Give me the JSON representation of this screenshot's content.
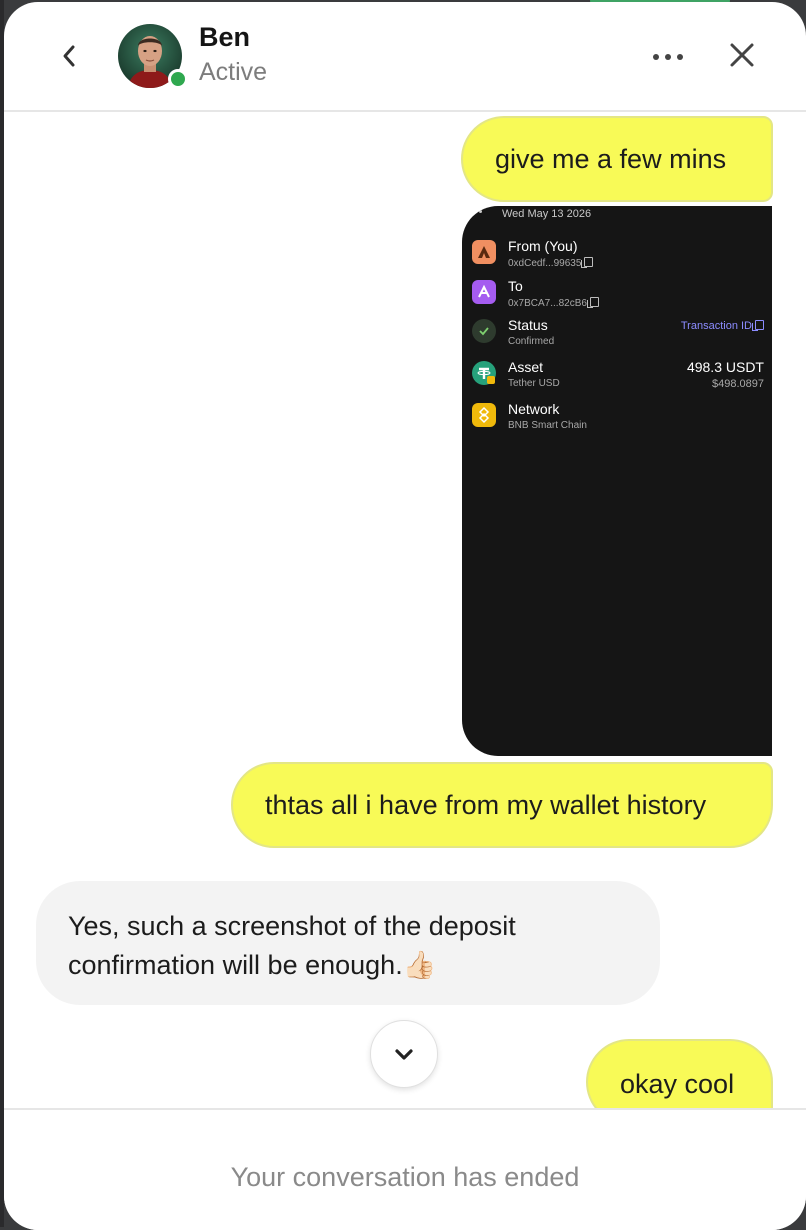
{
  "colors": {
    "bubble_out": "#f8fa57",
    "bubble_in": "#f3f3f3",
    "online": "#2fa84f",
    "link": "#8c8cff"
  },
  "header": {
    "name": "Ben",
    "status": "Active",
    "icons": [
      "back-chevron-icon",
      "avatar",
      "more-dots-icon",
      "close-icon"
    ]
  },
  "messages": {
    "m1": "give me a few mins",
    "m2": "thtas all i have from my wallet history",
    "m3": "Yes, such a screenshot of the deposit confirmation will be enough.👍🏻",
    "m4": "okay cool"
  },
  "shot": {
    "date": "Wed May 13 2026",
    "from_title": "From (You)",
    "from_addr": "0xdCedf...99635",
    "to_title": "To",
    "to_addr": "0x7BCA7...82cB6",
    "status_title": "Status",
    "status_value": "Confirmed",
    "txid_label": "Transaction ID",
    "asset_title": "Asset",
    "asset_name": "Tether USD",
    "asset_amount": "498.3 USDT",
    "asset_usd": "$498.0897",
    "network_title": "Network",
    "network_name": "BNB Smart Chain"
  },
  "footer": {
    "ended": "Your conversation has ended"
  }
}
